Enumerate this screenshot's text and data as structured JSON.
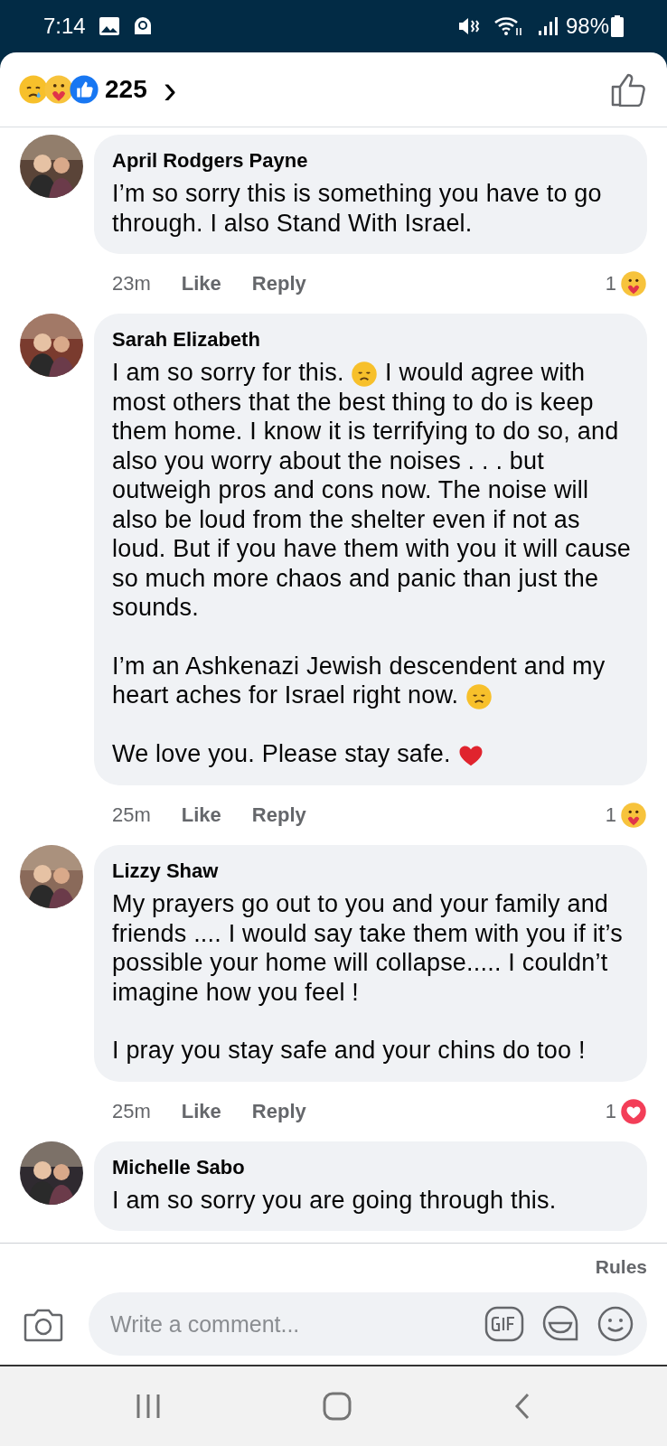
{
  "status_bar": {
    "time": "7:14",
    "battery": "98%"
  },
  "header": {
    "reactions": [
      {
        "kind": "sad"
      },
      {
        "kind": "care"
      },
      {
        "kind": "like"
      }
    ],
    "count": "225",
    "chevron": "›"
  },
  "comments": [
    {
      "author": "April Rodgers Payne",
      "avatar": {
        "kind": "picture"
      },
      "paragraphs": [
        [
          {
            "text": "I’m so sorry this is something you have to go through. I also Stand With Israel."
          }
        ]
      ],
      "time": "23m",
      "like": "Like",
      "reply": "Reply",
      "reaction_count": "1",
      "reaction": {
        "kind": "care"
      }
    },
    {
      "author": "Sarah Elizabeth",
      "avatar": {
        "kind": "picture"
      },
      "paragraphs": [
        [
          {
            "text": "I am so sorry for this. "
          },
          {
            "kind": "sad"
          },
          {
            "text": " I would agree with most others that the best thing to do is keep them home. I know it is terrifying to do so, and also you worry about the noises . . . but outweigh pros and cons now. The noise will also be loud from the shelter even if not as loud. But if you have them with you it will cause so much more chaos and panic than just the sounds."
          }
        ],
        [
          {
            "text": "I’m an Ashkenazi Jewish descendent and my heart aches for Israel right now. "
          },
          {
            "kind": "sad"
          }
        ],
        [
          {
            "text": "We love you. Please stay safe. "
          },
          {
            "kind": "heart"
          }
        ]
      ],
      "time": "25m",
      "like": "Like",
      "reply": "Reply",
      "reaction_count": "1",
      "reaction": {
        "kind": "care"
      }
    },
    {
      "author": "Lizzy Shaw",
      "avatar": {
        "kind": "picture"
      },
      "paragraphs": [
        [
          {
            "text": "My prayers go out to you and your family and friends .... I would say take them with you if it’s possible your home will collapse..... I couldn’t imagine how you feel !"
          }
        ],
        [
          {
            "text": "I pray you stay safe and your chins do too !"
          }
        ]
      ],
      "time": "25m",
      "like": "Like",
      "reply": "Reply",
      "reaction_count": "1",
      "reaction": {
        "kind": "love"
      }
    },
    {
      "author": "Michelle Sabo",
      "avatar": {
        "kind": "picture"
      },
      "paragraphs": [
        [
          {
            "text": "I am so sorry you are going through this."
          }
        ]
      ]
    }
  ],
  "composer": {
    "rules": "Rules",
    "placeholder": "Write a comment..."
  }
}
